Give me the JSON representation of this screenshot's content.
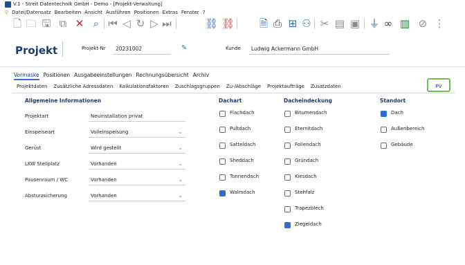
{
  "window": {
    "title": "V.1 - Streit Datentechnik GmbH - Demo - [Projekt-Verwaltung]"
  },
  "menu": [
    "Datei/Datensatz",
    "Bearbeiten",
    "Ansicht",
    "Ausführen",
    "Positionen",
    "Extras",
    "Fenster",
    "?"
  ],
  "toolbar": {
    "icons": [
      "new-doc-icon",
      "open-icon",
      "save-icon",
      "copy-icon",
      "delete-icon",
      "search-icon",
      "first-icon",
      "prev-icon",
      "refresh-icon",
      "next-icon",
      "last-icon",
      "link-icon",
      "unlink-icon",
      "preview-icon",
      "print-icon",
      "tree-icon",
      "users-icon",
      "cut-icon",
      "paste-icon",
      "clipboard-icon",
      "filter-icon",
      "glasses-icon",
      "chart-icon",
      "attach-icon"
    ]
  },
  "project": {
    "title": "Projekt",
    "nr_label": "Projekt-Nr",
    "nr_value": "20231002",
    "kunde_label": "Kunde",
    "kunde_value": "Ludwig Ackermann GmbH"
  },
  "tabs_main": [
    "Vormaske",
    "Positionen",
    "Ausgabeeinstellungen",
    "Rechnungsübersicht",
    "Archiv"
  ],
  "tabs_sub": [
    "Projektdaten",
    "Zusätzliche Adressdaten",
    "Kalkulationsfaktoren",
    "Zuschlagsgruppen",
    "Zu-/Abschläge",
    "Projektaufträge",
    "Zusatzdaten"
  ],
  "active_subtab": "PV",
  "general": {
    "heading": "Allgemeine Informationen",
    "fields": [
      {
        "label": "Projektart",
        "value": "Neuinstallation privat",
        "dropdown": false
      },
      {
        "label": "Einspeiseart",
        "value": "Volleinspeisung",
        "dropdown": true
      },
      {
        "label": "Gerüst",
        "value": "Wird gestellt",
        "dropdown": true
      },
      {
        "label": "LKW Stellplatz",
        "value": "Vorhanden",
        "dropdown": true
      },
      {
        "label": "Pausenraum / WC",
        "value": "Vorhanden",
        "dropdown": true
      },
      {
        "label": "Absturzsicherung",
        "value": "Vorhanden",
        "dropdown": true
      }
    ]
  },
  "dachart": {
    "heading": "Dachart",
    "options": [
      {
        "label": "Flachdach",
        "checked": false
      },
      {
        "label": "Pultdach",
        "checked": false
      },
      {
        "label": "Satteldach",
        "checked": false
      },
      {
        "label": "Sheddach",
        "checked": false
      },
      {
        "label": "Tonnendach",
        "checked": false
      },
      {
        "label": "Walmdach",
        "checked": true
      }
    ]
  },
  "dacheindeckung": {
    "heading": "Dacheindeckung",
    "options": [
      {
        "label": "Bitumendach",
        "checked": false
      },
      {
        "label": "Eternitdach",
        "checked": false
      },
      {
        "label": "Foliendach",
        "checked": false
      },
      {
        "label": "Gründach",
        "checked": false
      },
      {
        "label": "Kiesdach",
        "checked": false
      },
      {
        "label": "Stehfalz",
        "checked": false
      },
      {
        "label": "Trapezblech",
        "checked": false
      },
      {
        "label": "Ziegeldach",
        "checked": true
      }
    ]
  },
  "standort": {
    "heading": "Standort",
    "options": [
      {
        "label": "Dach",
        "checked": true
      },
      {
        "label": "Außenbereich",
        "checked": false
      },
      {
        "label": "Gebäude",
        "checked": false
      }
    ]
  },
  "colors": {
    "accent": "#2f6fd0",
    "title_blue": "#1b3d73",
    "highlight_green": "#6cc04a",
    "delete_red": "#d41f1f"
  }
}
